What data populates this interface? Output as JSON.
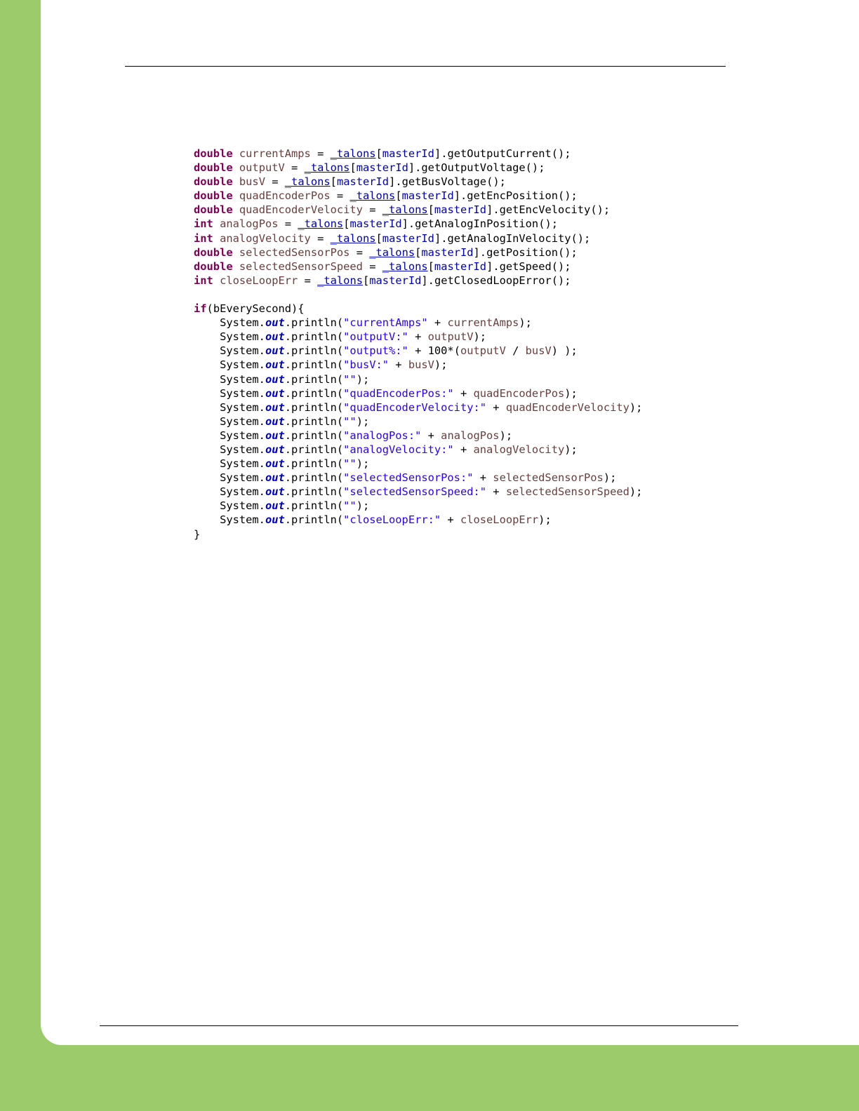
{
  "code_lines": [
    [
      {
        "t": "double",
        "c": "kw"
      },
      {
        "t": " "
      },
      {
        "t": "currentAmps",
        "c": "var"
      },
      {
        "t": " = "
      },
      {
        "t": "_talons",
        "c": "fld ul"
      },
      {
        "t": "["
      },
      {
        "t": "masterId",
        "c": "fld"
      },
      {
        "t": "].getOutputCurrent();"
      }
    ],
    [
      {
        "t": "double",
        "c": "kw"
      },
      {
        "t": " "
      },
      {
        "t": "outputV",
        "c": "var"
      },
      {
        "t": " = "
      },
      {
        "t": "_talons",
        "c": "fld ul"
      },
      {
        "t": "["
      },
      {
        "t": "masterId",
        "c": "fld"
      },
      {
        "t": "].getOutputVoltage();"
      }
    ],
    [
      {
        "t": "double",
        "c": "kw"
      },
      {
        "t": " "
      },
      {
        "t": "busV",
        "c": "var"
      },
      {
        "t": " = "
      },
      {
        "t": "_talons",
        "c": "fld ul"
      },
      {
        "t": "["
      },
      {
        "t": "masterId",
        "c": "fld"
      },
      {
        "t": "].getBusVoltage();"
      }
    ],
    [
      {
        "t": "double",
        "c": "kw"
      },
      {
        "t": " "
      },
      {
        "t": "quadEncoderPos",
        "c": "var"
      },
      {
        "t": " = "
      },
      {
        "t": "_talons",
        "c": "fld ul"
      },
      {
        "t": "["
      },
      {
        "t": "masterId",
        "c": "fld"
      },
      {
        "t": "].getEncPosition();"
      }
    ],
    [
      {
        "t": "double",
        "c": "kw"
      },
      {
        "t": " "
      },
      {
        "t": "quadEncoderVelocity",
        "c": "var"
      },
      {
        "t": " = "
      },
      {
        "t": "_talons",
        "c": "fld ul"
      },
      {
        "t": "["
      },
      {
        "t": "masterId",
        "c": "fld"
      },
      {
        "t": "].getEncVelocity();"
      }
    ],
    [
      {
        "t": "int",
        "c": "kw"
      },
      {
        "t": " "
      },
      {
        "t": "analogPos",
        "c": "var"
      },
      {
        "t": " = "
      },
      {
        "t": "_talons",
        "c": "fld ul"
      },
      {
        "t": "["
      },
      {
        "t": "masterId",
        "c": "fld"
      },
      {
        "t": "].getAnalogInPosition();"
      }
    ],
    [
      {
        "t": "int",
        "c": "kw"
      },
      {
        "t": " "
      },
      {
        "t": "analogVelocity",
        "c": "var"
      },
      {
        "t": " = "
      },
      {
        "t": "_talons",
        "c": "fld ul"
      },
      {
        "t": "["
      },
      {
        "t": "masterId",
        "c": "fld"
      },
      {
        "t": "].getAnalogInVelocity();"
      }
    ],
    [
      {
        "t": "double",
        "c": "kw"
      },
      {
        "t": " "
      },
      {
        "t": "selectedSensorPos",
        "c": "var"
      },
      {
        "t": " = "
      },
      {
        "t": "_talons",
        "c": "fld ul"
      },
      {
        "t": "["
      },
      {
        "t": "masterId",
        "c": "fld"
      },
      {
        "t": "].getPosition();"
      }
    ],
    [
      {
        "t": "double",
        "c": "kw"
      },
      {
        "t": " "
      },
      {
        "t": "selectedSensorSpeed",
        "c": "var"
      },
      {
        "t": " = "
      },
      {
        "t": "_talons",
        "c": "fld ul"
      },
      {
        "t": "["
      },
      {
        "t": "masterId",
        "c": "fld"
      },
      {
        "t": "].getSpeed();"
      }
    ],
    [
      {
        "t": "int",
        "c": "kw"
      },
      {
        "t": " "
      },
      {
        "t": "closeLoopErr",
        "c": "var"
      },
      {
        "t": " = "
      },
      {
        "t": "_talons",
        "c": "fld ul"
      },
      {
        "t": "["
      },
      {
        "t": "masterId",
        "c": "fld"
      },
      {
        "t": "].getClosedLoopError();"
      }
    ],
    [],
    [
      {
        "t": "if",
        "c": "kw"
      },
      {
        "t": "(bEverySecond){"
      }
    ],
    [
      {
        "t": "    System."
      },
      {
        "t": "out",
        "c": "st"
      },
      {
        "t": ".println("
      },
      {
        "t": "\"currentAmps\"",
        "c": "str"
      },
      {
        "t": " + "
      },
      {
        "t": "currentAmps",
        "c": "var"
      },
      {
        "t": ");"
      }
    ],
    [
      {
        "t": "    System."
      },
      {
        "t": "out",
        "c": "st"
      },
      {
        "t": ".println("
      },
      {
        "t": "\"outputV:\"",
        "c": "str"
      },
      {
        "t": " + "
      },
      {
        "t": "outputV",
        "c": "var"
      },
      {
        "t": ");"
      }
    ],
    [
      {
        "t": "    System."
      },
      {
        "t": "out",
        "c": "st"
      },
      {
        "t": ".println("
      },
      {
        "t": "\"output%:\"",
        "c": "str"
      },
      {
        "t": " + 100*("
      },
      {
        "t": "outputV",
        "c": "var"
      },
      {
        "t": " / "
      },
      {
        "t": "busV",
        "c": "var"
      },
      {
        "t": ") );"
      }
    ],
    [
      {
        "t": "    System."
      },
      {
        "t": "out",
        "c": "st"
      },
      {
        "t": ".println("
      },
      {
        "t": "\"busV:\"",
        "c": "str"
      },
      {
        "t": " + "
      },
      {
        "t": "busV",
        "c": "var"
      },
      {
        "t": ");"
      }
    ],
    [
      {
        "t": "    System."
      },
      {
        "t": "out",
        "c": "st"
      },
      {
        "t": ".println("
      },
      {
        "t": "\"\"",
        "c": "str"
      },
      {
        "t": ");"
      }
    ],
    [
      {
        "t": "    System."
      },
      {
        "t": "out",
        "c": "st"
      },
      {
        "t": ".println("
      },
      {
        "t": "\"quadEncoderPos:\"",
        "c": "str"
      },
      {
        "t": " + "
      },
      {
        "t": "quadEncoderPos",
        "c": "var"
      },
      {
        "t": ");"
      }
    ],
    [
      {
        "t": "    System."
      },
      {
        "t": "out",
        "c": "st"
      },
      {
        "t": ".println("
      },
      {
        "t": "\"quadEncoderVelocity:\"",
        "c": "str"
      },
      {
        "t": " + "
      },
      {
        "t": "quadEncoderVelocity",
        "c": "var"
      },
      {
        "t": ");"
      }
    ],
    [
      {
        "t": "    System."
      },
      {
        "t": "out",
        "c": "st"
      },
      {
        "t": ".println("
      },
      {
        "t": "\"\"",
        "c": "str"
      },
      {
        "t": ");"
      }
    ],
    [
      {
        "t": "    System."
      },
      {
        "t": "out",
        "c": "st"
      },
      {
        "t": ".println("
      },
      {
        "t": "\"analogPos:\"",
        "c": "str"
      },
      {
        "t": " + "
      },
      {
        "t": "analogPos",
        "c": "var"
      },
      {
        "t": ");"
      }
    ],
    [
      {
        "t": "    System."
      },
      {
        "t": "out",
        "c": "st"
      },
      {
        "t": ".println("
      },
      {
        "t": "\"analogVelocity:\"",
        "c": "str"
      },
      {
        "t": " + "
      },
      {
        "t": "analogVelocity",
        "c": "var"
      },
      {
        "t": ");"
      }
    ],
    [
      {
        "t": "    System."
      },
      {
        "t": "out",
        "c": "st"
      },
      {
        "t": ".println("
      },
      {
        "t": "\"\"",
        "c": "str"
      },
      {
        "t": ");"
      }
    ],
    [
      {
        "t": "    System."
      },
      {
        "t": "out",
        "c": "st"
      },
      {
        "t": ".println("
      },
      {
        "t": "\"selectedSensorPos:\"",
        "c": "str"
      },
      {
        "t": " + "
      },
      {
        "t": "selectedSensorPos",
        "c": "var"
      },
      {
        "t": ");"
      }
    ],
    [
      {
        "t": "    System."
      },
      {
        "t": "out",
        "c": "st"
      },
      {
        "t": ".println("
      },
      {
        "t": "\"selectedSensorSpeed:\"",
        "c": "str"
      },
      {
        "t": " + "
      },
      {
        "t": "selectedSensorSpeed",
        "c": "var"
      },
      {
        "t": ");"
      }
    ],
    [
      {
        "t": "    System."
      },
      {
        "t": "out",
        "c": "st"
      },
      {
        "t": ".println("
      },
      {
        "t": "\"\"",
        "c": "str"
      },
      {
        "t": ");"
      }
    ],
    [
      {
        "t": "    System."
      },
      {
        "t": "out",
        "c": "st"
      },
      {
        "t": ".println("
      },
      {
        "t": "\"closeLoopErr:\"",
        "c": "str"
      },
      {
        "t": " + "
      },
      {
        "t": "closeLoopErr",
        "c": "var"
      },
      {
        "t": ");"
      }
    ],
    [
      {
        "t": "}"
      }
    ]
  ]
}
